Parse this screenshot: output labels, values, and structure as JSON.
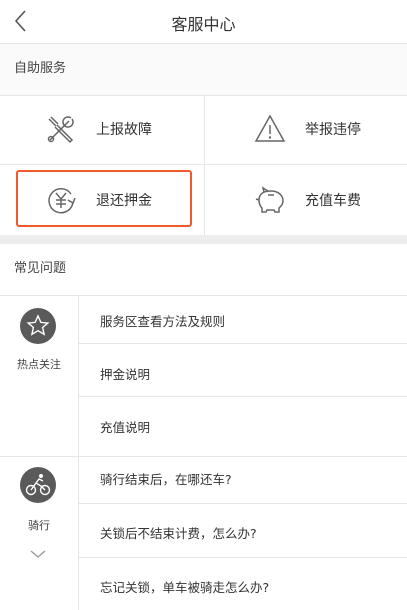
{
  "header": {
    "title": "客服中心",
    "back_icon": "chevron-left-icon"
  },
  "self_service": {
    "heading": "自助服务",
    "items": [
      {
        "label": "上报故障",
        "icon": "wrench-screwdriver-icon"
      },
      {
        "label": "举报违停",
        "icon": "warning-triangle-icon"
      },
      {
        "label": "退还押金",
        "icon": "yen-refund-icon"
      },
      {
        "label": "充值车费",
        "icon": "piggy-bank-icon"
      }
    ],
    "highlight_color": "#f05a28"
  },
  "faq": {
    "heading": "常见问题",
    "categories": [
      {
        "label": "热点关注",
        "icon": "star-icon",
        "questions": [
          "服务区查看方法及规则",
          "押金说明",
          "充值说明"
        ]
      },
      {
        "label": "骑行",
        "icon": "bike-rider-icon",
        "expand_icon": "chevron-down-icon",
        "questions": [
          "骑行结束后，在哪还车?",
          "关锁后不结束计费，怎么办?",
          "忘记关锁，单车被骑走怎么办?"
        ]
      }
    ]
  }
}
